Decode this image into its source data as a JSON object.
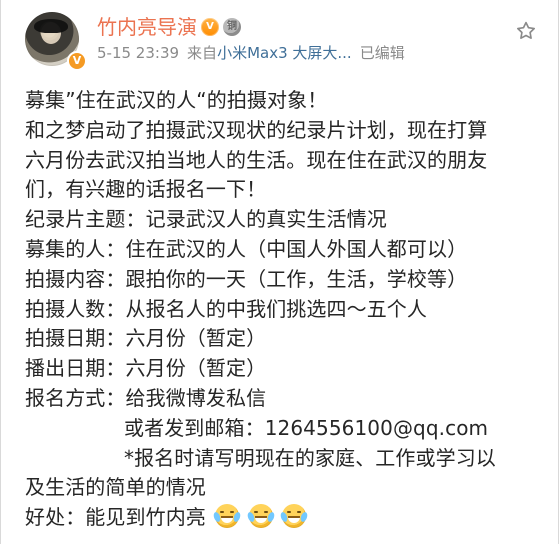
{
  "header": {
    "username": "竹内亮导演",
    "badges": {
      "vip": "V",
      "medal": "铜"
    },
    "timestamp": "5-15 23:39",
    "source_prefix": "来自",
    "source": "小米Max3 大屏大...",
    "edited": "已编辑",
    "icons": {
      "star": "star-outline-icon",
      "verified": "verified-badge-icon"
    }
  },
  "post": {
    "lines": [
      "募集”住在武汉的人“的拍摄对象！",
      "和之梦启动了拍摄武汉现状的纪录片计划，现在打算",
      "六月份去武汉拍当地人的生活。现在住在武汉的朋友",
      "们，有兴趣的话报名一下！",
      "纪录片主题：记录武汉人的真实生活情况",
      "募集的人：住在武汉的人（中国人外国人都可以）",
      "拍摄内容：跟拍你的一天（工作，生活，学校等）",
      "拍摄人数：从报名人的中我们挑选四～五个人",
      "拍摄日期：六月份（暂定）",
      "播出日期：六月份（暂定）",
      "报名方式：给我微博发私信",
      "或者发到邮箱：1264556100@qq.com",
      "*报名时请写明现在的家庭、工作或学习以",
      "及生活的简单的情况",
      "好处：能见到竹内亮"
    ],
    "emojis": [
      "laughing-tears-icon",
      "laughing-tears-icon",
      "laughing-tears-icon"
    ]
  },
  "colors": {
    "name": "#eb7350",
    "meta": "#8a8a8a",
    "link": "#3f6f98",
    "text": "#262626"
  }
}
